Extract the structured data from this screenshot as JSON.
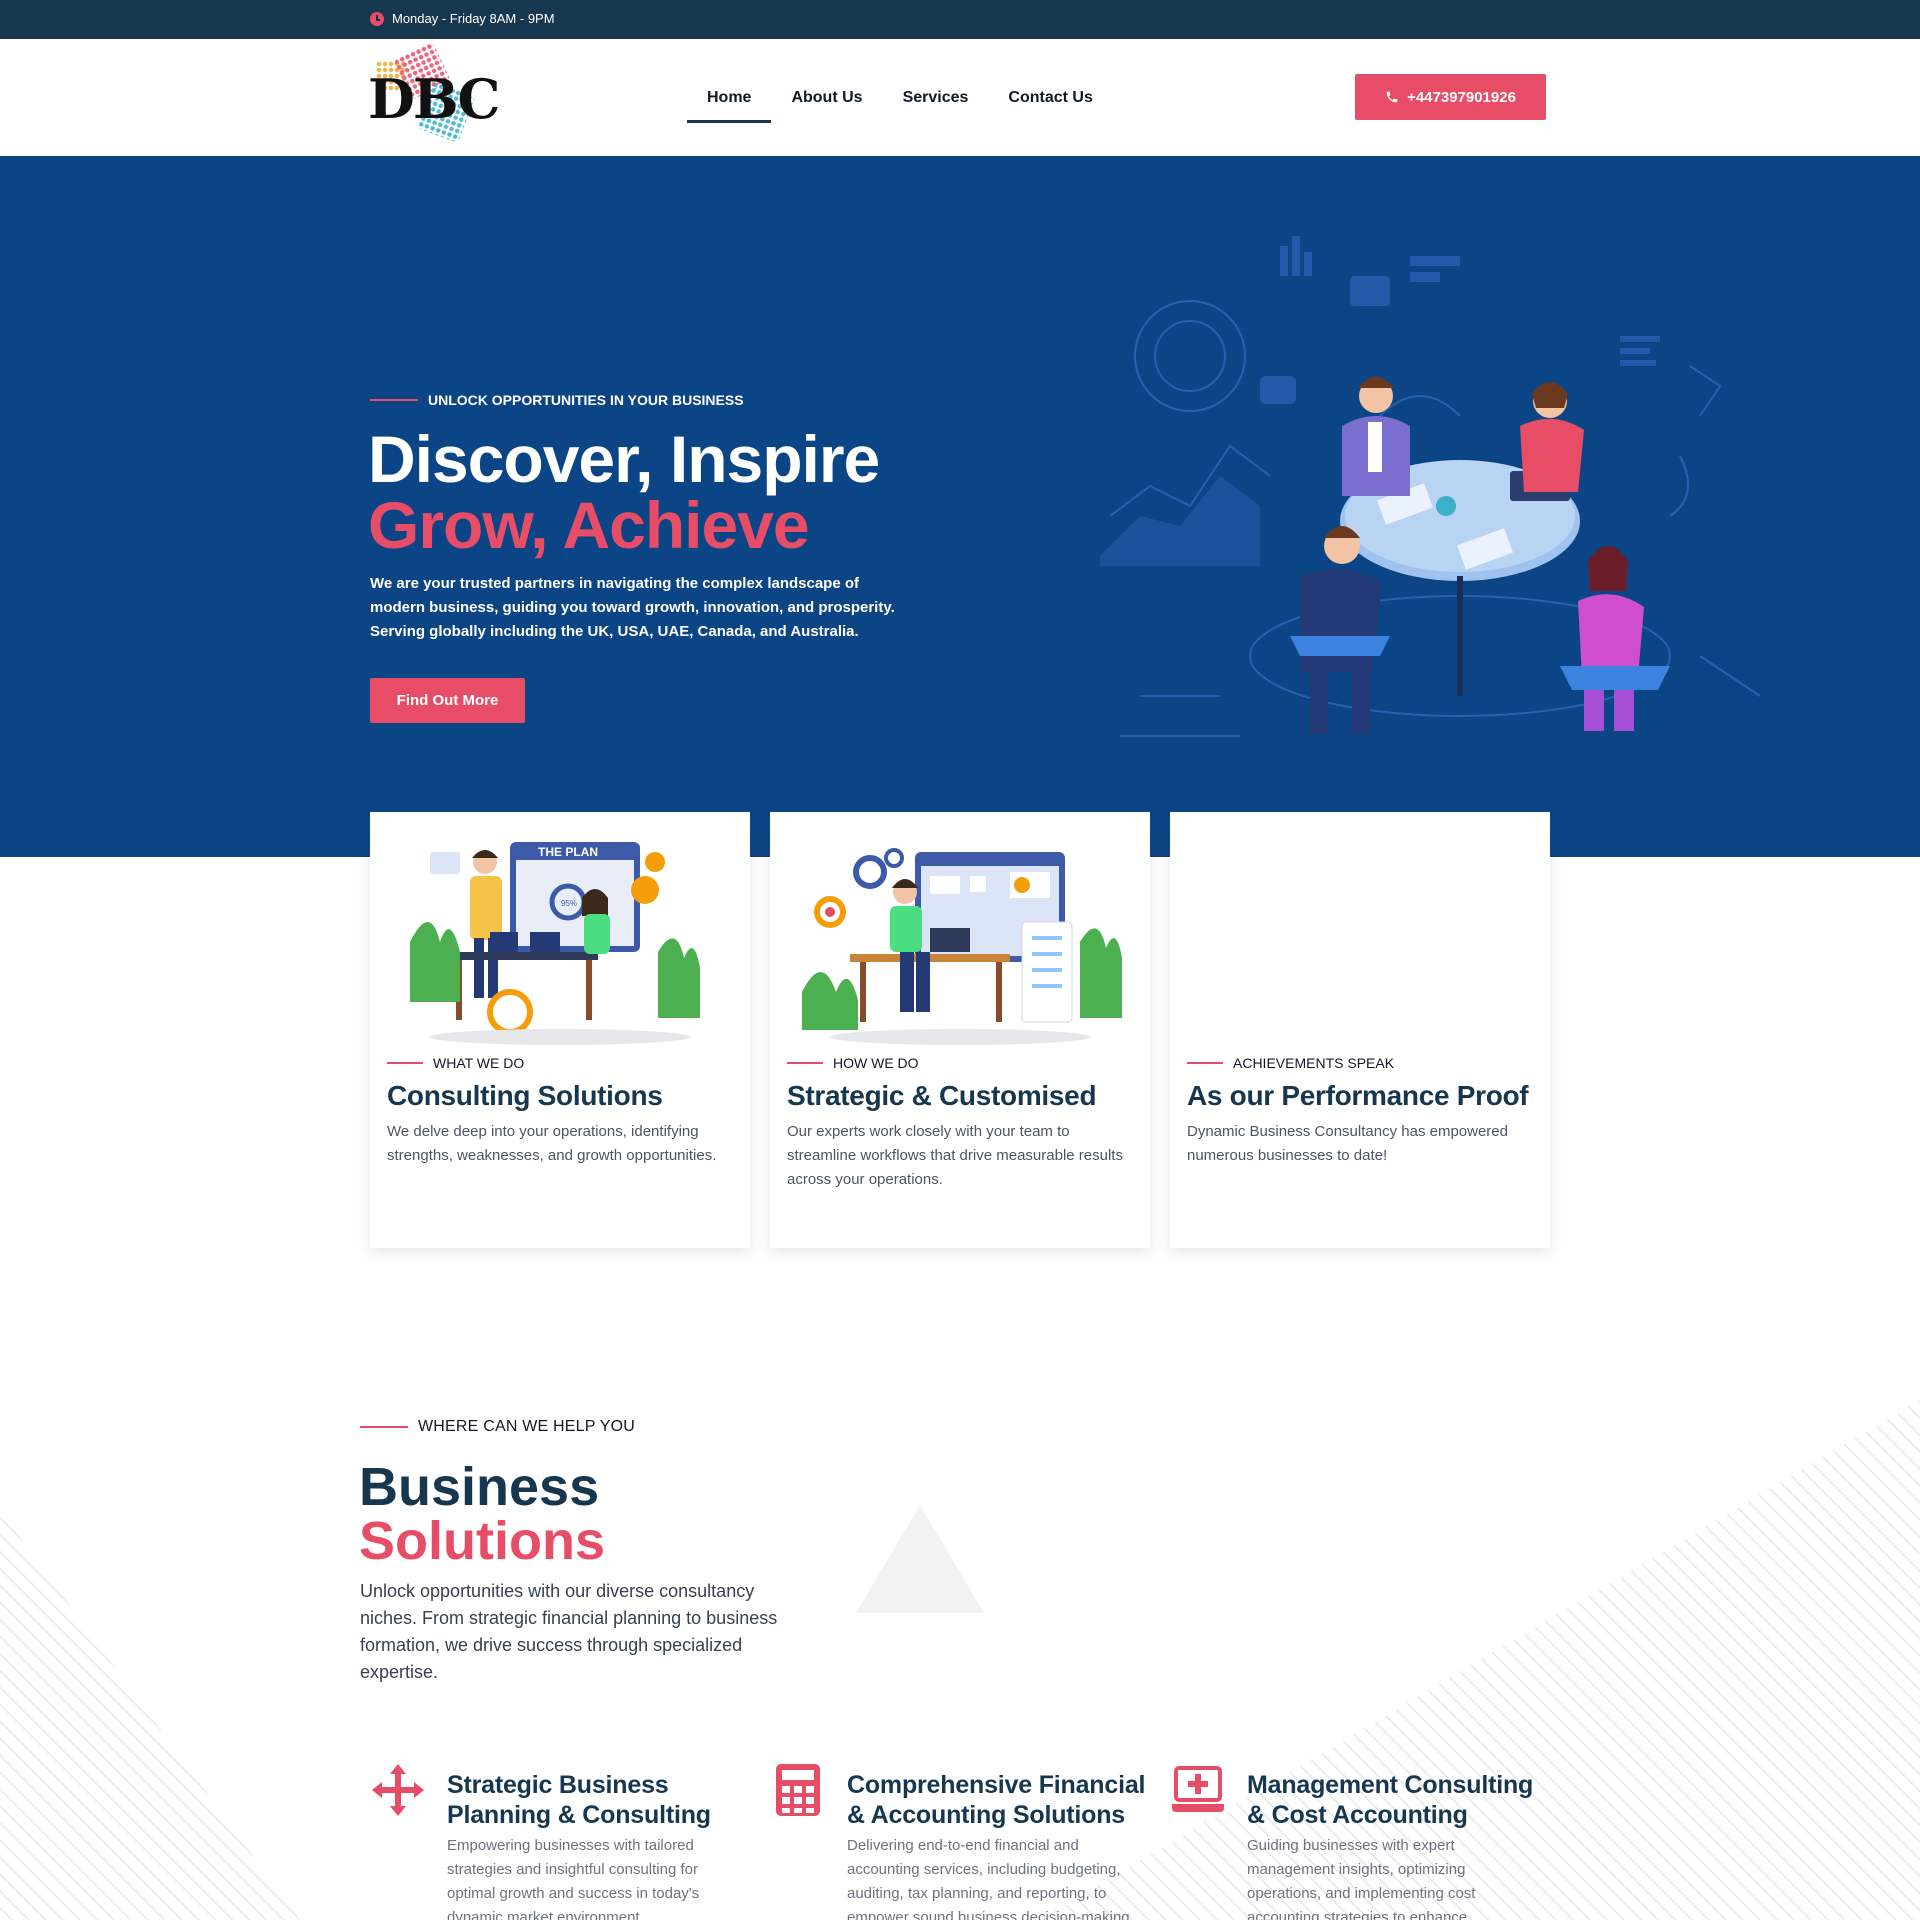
{
  "topbar": {
    "hours": "Monday - Friday 8AM - 9PM"
  },
  "header": {
    "logo_text": "DBC",
    "nav": [
      {
        "label": "Home",
        "active": true
      },
      {
        "label": "About Us"
      },
      {
        "label": "Services"
      },
      {
        "label": "Contact Us"
      }
    ],
    "phone": "+447397901926"
  },
  "hero": {
    "eyebrow": "UNLOCK OPPORTUNITIES IN YOUR BUSINESS",
    "title_line1": "Discover, Inspire",
    "title_line2": "Grow, Achieve",
    "description": "We are your trusted partners in navigating the complex landscape of modern business, guiding you toward growth, innovation, and prosperity. Serving globally including the UK, USA, UAE, Canada, and Australia.",
    "cta": "Find Out More"
  },
  "cards": [
    {
      "eyebrow": "WHAT WE DO",
      "title": "Consulting Solutions",
      "desc": "We delve deep into your operations, identifying strengths, weaknesses, and growth opportunities.",
      "illus_text": "THE PLAN",
      "illus_percent": "95%"
    },
    {
      "eyebrow": "HOW WE DO",
      "title": "Strategic & Customised",
      "desc": "Our experts work closely with your team to streamline workflows that drive measurable results across your operations."
    },
    {
      "eyebrow": "ACHIEVEMENTS SPEAK",
      "title": "As our Performance Proof",
      "desc": "Dynamic Business Consultancy has empowered numerous businesses to date!"
    }
  ],
  "solutions": {
    "eyebrow": "WHERE CAN WE HELP YOU",
    "title_line1": "Business",
    "title_line2": "Solutions",
    "description": "Unlock opportunities with our diverse consultancy niches. From strategic financial planning to business formation, we drive success through specialized expertise.",
    "services": [
      {
        "icon": "arrows-move-icon",
        "title": "Strategic Business Planning & Consulting",
        "desc": "Empowering businesses with tailored strategies and insightful consulting for optimal growth and success in today's dynamic market environment."
      },
      {
        "icon": "calculator-icon",
        "title": "Comprehensive Financial & Accounting Solutions",
        "desc": "Delivering end-to-end financial and accounting services, including budgeting, auditing, tax planning, and reporting, to empower sound business decision-making."
      },
      {
        "icon": "medical-laptop-icon",
        "title": "Management Consulting & Cost Accounting",
        "desc": "Guiding businesses with expert management insights, optimizing operations, and implementing cost accounting strategies to enhance profitability."
      }
    ]
  },
  "colors": {
    "primary_navy": "#17374f",
    "hero_blue": "#0c4586",
    "accent_pink": "#e84d67"
  }
}
